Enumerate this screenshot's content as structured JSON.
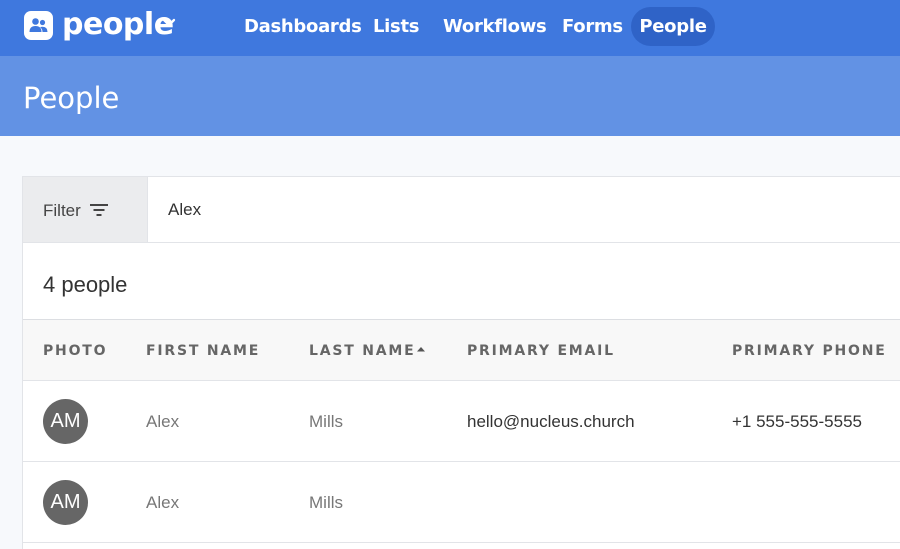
{
  "app": {
    "name": "people"
  },
  "nav": [
    {
      "label": "Dashboards"
    },
    {
      "label": "Lists"
    },
    {
      "label": "Workflows"
    },
    {
      "label": "Forms"
    },
    {
      "label": "People",
      "active": true
    }
  ],
  "page": {
    "title": "People"
  },
  "filter": {
    "label": "Filter",
    "value": "Alex"
  },
  "results": {
    "count_text": "4 people"
  },
  "table": {
    "columns": [
      "PHOTO",
      "FIRST NAME",
      "LAST NAME",
      "PRIMARY EMAIL",
      "PRIMARY PHONE"
    ],
    "sorted_by": "LAST NAME",
    "sort_direction": "ascending",
    "rows": [
      {
        "initials": "AM",
        "first_name": "Alex",
        "last_name": "Mills",
        "email": "hello@nucleus.church",
        "phone": "+1 555-555-5555"
      },
      {
        "initials": "AM",
        "first_name": "Alex",
        "last_name": "Mills",
        "email": "",
        "phone": ""
      }
    ]
  },
  "colors": {
    "topbar": "#3f78de",
    "titlebar": "#6292e4",
    "active_nav": "#2f63c7",
    "avatar": "#666666"
  }
}
